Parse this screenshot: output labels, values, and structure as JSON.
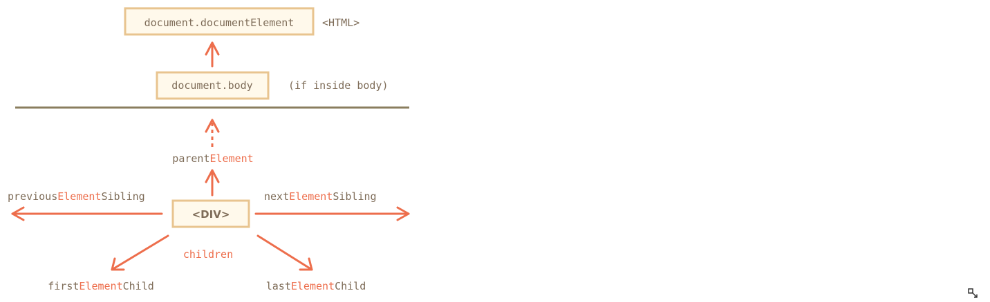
{
  "nodes": {
    "document_element": "document.documentElement",
    "html_tag": "<HTML>",
    "body": "document.body",
    "body_note": "(if inside body)",
    "div": "<DIV>"
  },
  "relations": {
    "parent": {
      "prefix": "parent",
      "accent": "Element",
      "suffix": ""
    },
    "previous_sibling": {
      "prefix": "previous",
      "accent": "Element",
      "suffix": "Sibling"
    },
    "next_sibling": {
      "prefix": "next",
      "accent": "Element",
      "suffix": "Sibling"
    },
    "children": "children",
    "first_child": {
      "prefix": "first",
      "accent": "Element",
      "suffix": "Child"
    },
    "last_child": {
      "prefix": "last",
      "accent": "Element",
      "suffix": "Child"
    }
  },
  "colors": {
    "text": "#7e6c58",
    "accent": "#ed6e4c",
    "box_fill": "#fff9eb",
    "box_border": "#e8c48f",
    "divider": "#8a7d5e"
  },
  "icons": {
    "corner": "resize-handle-icon"
  }
}
